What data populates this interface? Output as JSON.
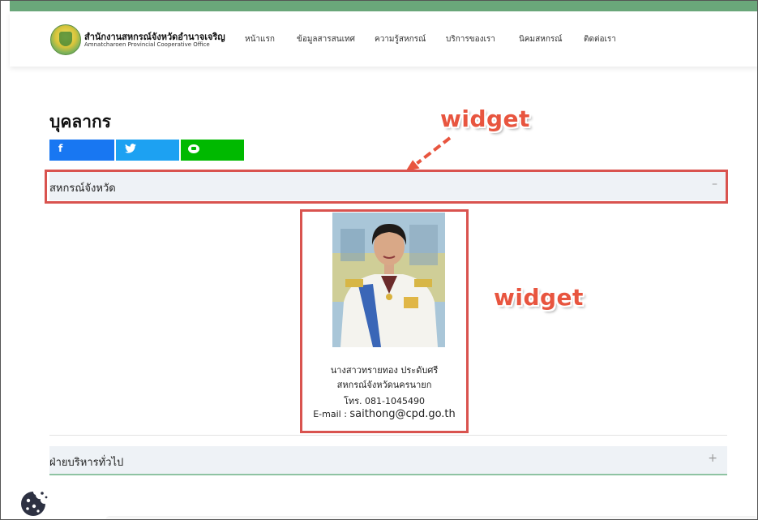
{
  "header": {
    "org_name": "สำนักงานสหกรณ์จังหวัดอำนาจเจริญ",
    "org_subtitle": "Amnatcharoen Provincial Cooperative Office",
    "nav": [
      {
        "label": "หน้าแรก"
      },
      {
        "label": "ข้อมูลสารสนเทศ"
      },
      {
        "label": "ความรู้สหกรณ์"
      },
      {
        "label": "บริการของเรา"
      },
      {
        "label": "นิคมสหกรณ์"
      },
      {
        "label": "ติดต่อเรา"
      }
    ]
  },
  "page": {
    "title": "บุคลากร"
  },
  "share": {
    "facebook_icon": "f",
    "twitter_icon": "twitter-icon",
    "line_icon": "line-icon"
  },
  "annotations": {
    "label_1": "widget",
    "label_2": "widget"
  },
  "accordions": [
    {
      "label": "สหกรณ์จังหวัด",
      "toggle": "–"
    },
    {
      "label": "ฝ่ายบริหารทั่วไป",
      "toggle": "+"
    }
  ],
  "person_card": {
    "name": "นางสาวทรายทอง ประดับศรี",
    "position": "สหกรณ์จังหวัดนครนายก",
    "tel": "โทร. 081-1045490",
    "email_label": "E-mail :",
    "email": "saithong@cpd.go.th"
  },
  "colors": {
    "accent_green": "#6aa77a",
    "annotation_red": "#d9534f",
    "facebook": "#1877f2",
    "twitter": "#1da1f2",
    "line": "#00b900"
  }
}
